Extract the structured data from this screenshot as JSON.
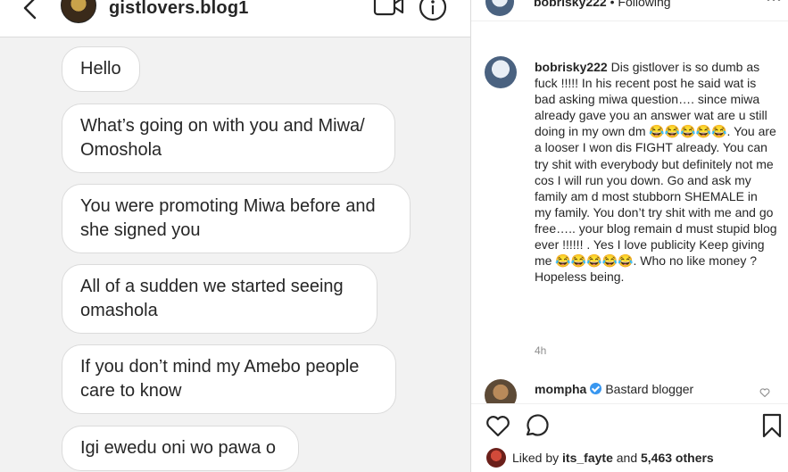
{
  "dm": {
    "username": "gistlovers.blog1",
    "messages": [
      "Hello",
      "What’s going on with you and Miwa/ Omoshola",
      "You were promoting Miwa before and she signed you",
      "All of a sudden we started seeing omashola",
      "If you don’t mind my Amebo people care to know",
      "Igi ewedu oni wo pawa o"
    ]
  },
  "post": {
    "header_user": "bobrisky222",
    "header_sep": " • ",
    "header_status": "Following",
    "caption_user": "bobrisky222",
    "caption_text": "Dis gistlover is so dumb as fuck !!!!! In his recent post he said wat is bad asking miwa question…. since miwa already gave you an answer wat are u still doing in my own dm 😂😂😂😂😂. You are a looser I won dis FIGHT already. You can try shit with everybody but definitely not me cos I will run you down. Go and ask my family am d most stubborn SHEMALE in my family. You don’t try shit with me and go free….. your blog remain d must stupid blog ever !!!!!! . Yes I love publicity Keep giving me 😂😂😂😂😂. Who no like money ? Hopeless being.",
    "caption_time": "4h",
    "comment_user": "mompha",
    "comment_text": "Bastard blogger",
    "liked_prefix": "Liked by",
    "liked_user": "its_fayte",
    "liked_mid": "and",
    "liked_count": "5,463 others"
  },
  "icons": {
    "back": "back-chevron-icon",
    "video": "video-call-icon",
    "info": "info-icon",
    "like": "heart-icon",
    "comment": "comment-icon",
    "save": "bookmark-icon"
  }
}
